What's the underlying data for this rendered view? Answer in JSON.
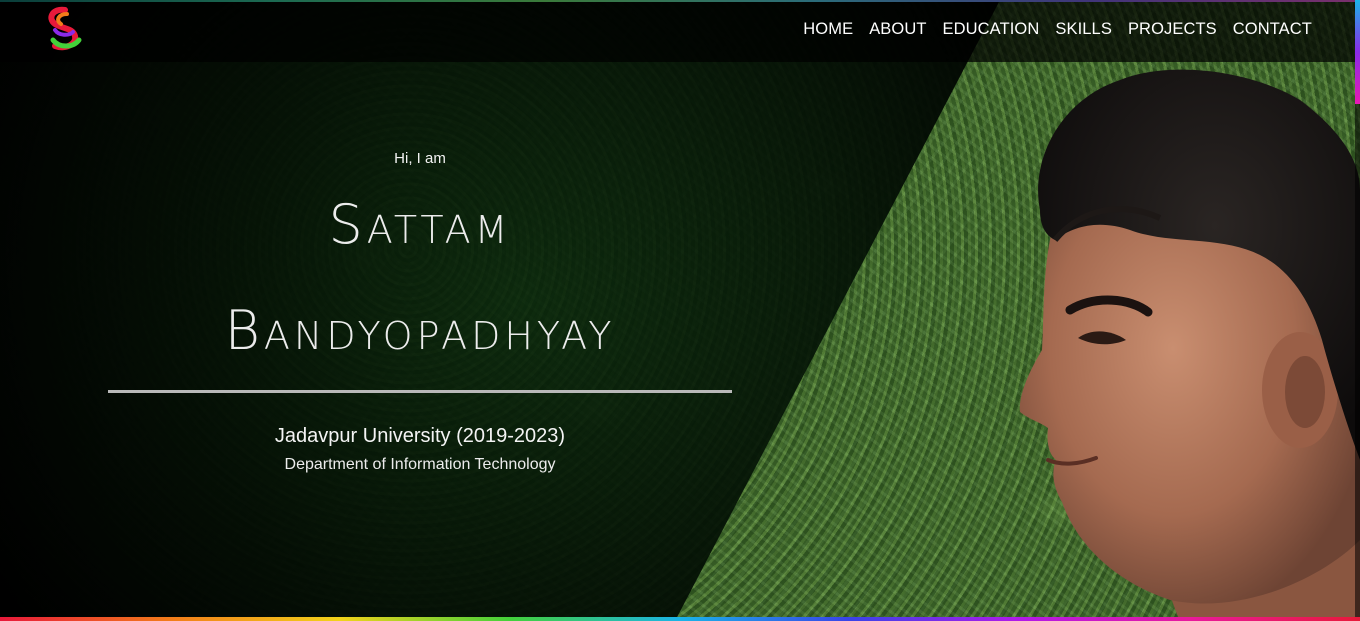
{
  "nav": {
    "items": [
      {
        "label": "HOME"
      },
      {
        "label": "ABOUT"
      },
      {
        "label": "EDUCATION"
      },
      {
        "label": "SKILLS"
      },
      {
        "label": "PROJECTS"
      },
      {
        "label": "CONTACT"
      }
    ]
  },
  "logo": {
    "icon": "s-swirl-logo-icon",
    "colors": [
      "#e8193a",
      "#f27c1a",
      "#43d13a",
      "#8a2be8"
    ]
  },
  "hero": {
    "greeting": "Hi, I am",
    "first_name": "Sattam",
    "last_name": "Bandyopadhyay",
    "university": "Jadavpur University (2019-2023)",
    "department": "Department of Information Technology"
  },
  "theme": {
    "accent_bar_colors": [
      "#e8193a",
      "#f27c1a",
      "#f2d31a",
      "#43d13a",
      "#1ab4e8",
      "#3a43e8",
      "#b21ae8",
      "#e81a9c"
    ],
    "text_color": "#ffffff",
    "divider_color": "#b9b9b9"
  }
}
